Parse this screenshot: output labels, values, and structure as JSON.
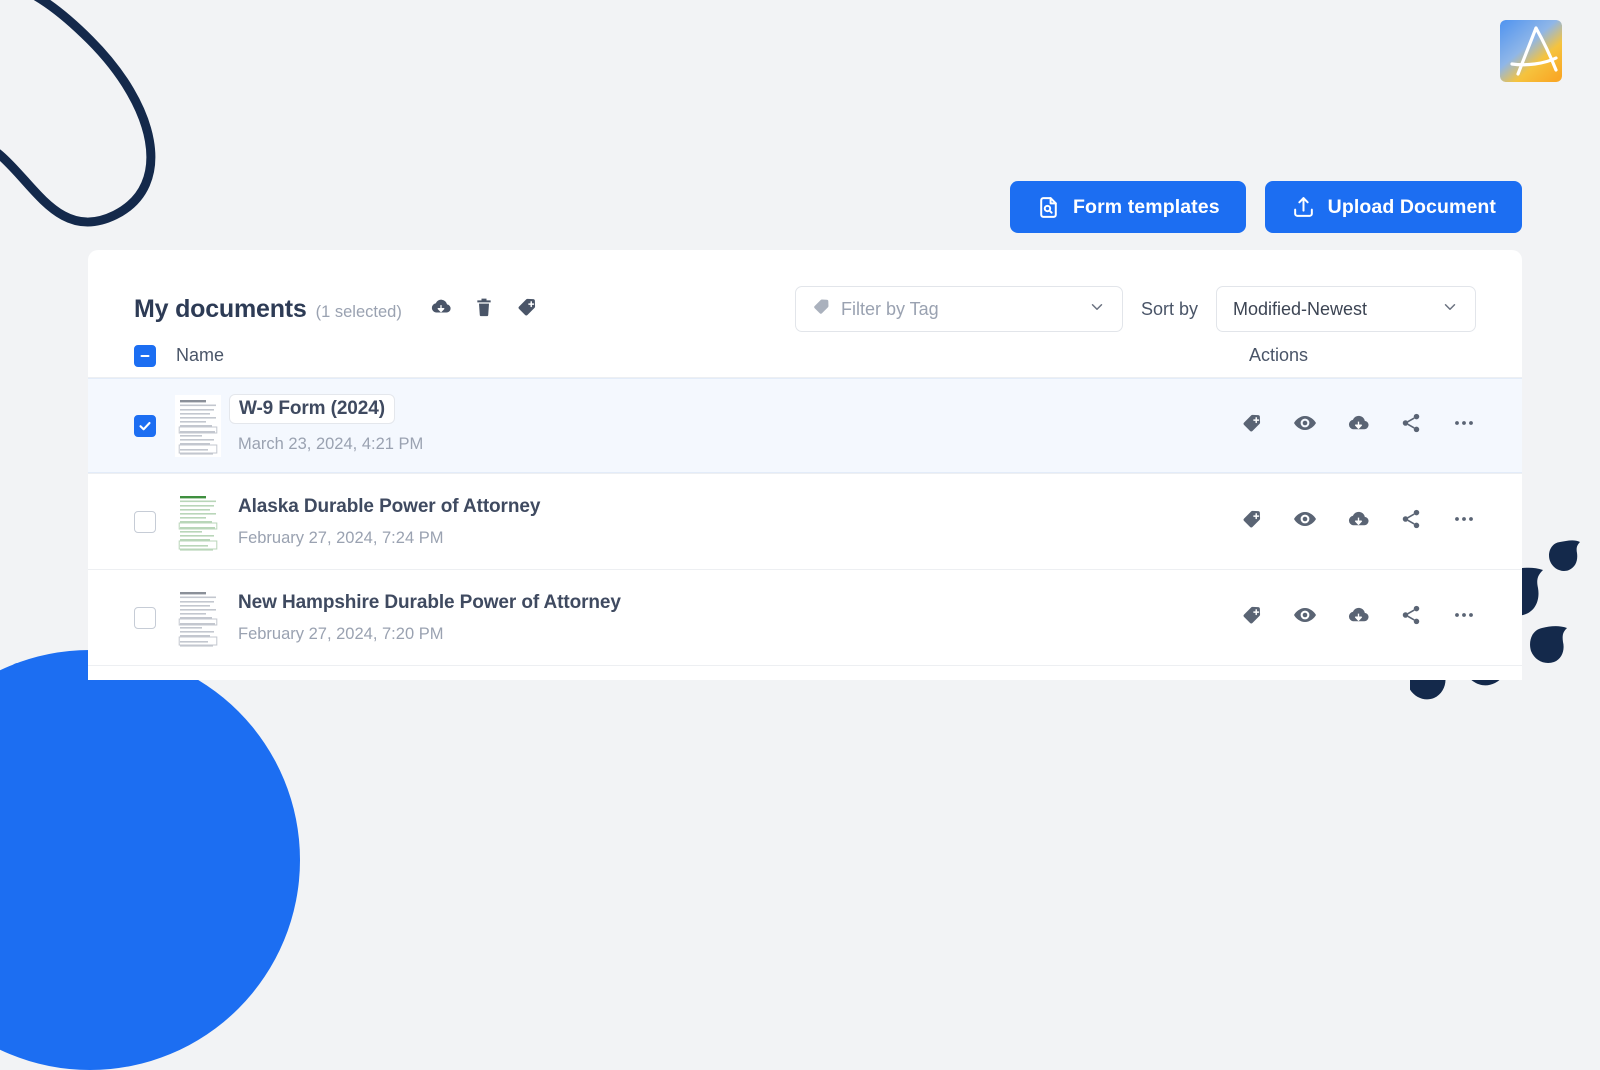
{
  "brand": {
    "logo_name": "pdf-app-logo",
    "accent_blue": "#1c6ef2",
    "navy": "#14294b",
    "page_background": "#f2f3f5"
  },
  "toolbar": {
    "form_templates_label": "Form templates",
    "upload_document_label": "Upload Document"
  },
  "panel": {
    "title": "My documents",
    "selected_count_text": "(1 selected)",
    "bulk_actions": [
      {
        "name": "download-cloud-icon",
        "label": "Download"
      },
      {
        "name": "trash-icon",
        "label": "Delete"
      },
      {
        "name": "tag-plus-icon",
        "label": "Add tag"
      }
    ],
    "filter": {
      "placeholder": "Filter by Tag",
      "icon": "tag-icon"
    },
    "sort": {
      "label": "Sort by",
      "value": "Modified-Newest"
    },
    "columns": {
      "name": "Name",
      "actions": "Actions"
    },
    "select_all_state": "indeterminate"
  },
  "documents": [
    {
      "name": "W-9 Form (2024)",
      "date": "March 23, 2024, 4:21 PM",
      "selected": true,
      "editing": true,
      "thumbnail_tint": "gray"
    },
    {
      "name": "Alaska Durable Power of Attorney",
      "date": "February 27, 2024, 7:24 PM",
      "selected": false,
      "editing": false,
      "thumbnail_tint": "green"
    },
    {
      "name": "New Hampshire Durable Power of Attorney",
      "date": "February 27, 2024, 7:20 PM",
      "selected": false,
      "editing": false,
      "thumbnail_tint": "gray"
    }
  ],
  "row_actions": [
    {
      "name": "tag-plus-icon",
      "label": "Tag"
    },
    {
      "name": "eye-icon",
      "label": "Preview"
    },
    {
      "name": "download-cloud-icon",
      "label": "Download"
    },
    {
      "name": "share-icon",
      "label": "Share"
    },
    {
      "name": "more-options-icon",
      "label": "More"
    }
  ]
}
